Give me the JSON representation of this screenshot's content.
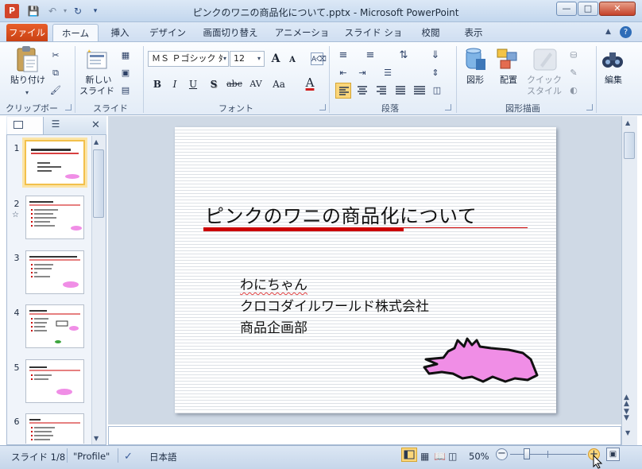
{
  "window": {
    "title": "ピンクのワニの商品化について.pptx - Microsoft PowerPoint",
    "app_icon_letter": "P"
  },
  "tabs": [
    "ファイル",
    "ホーム",
    "挿入",
    "デザイン",
    "画面切り替え",
    "アニメーション",
    "スライド ショー",
    "校閲",
    "表示"
  ],
  "ribbon": {
    "clipboard": {
      "paste_label": "貼り付け",
      "group_label": "クリップボード"
    },
    "slides": {
      "new_slide_label_1": "新しい",
      "new_slide_label_2": "スライド",
      "group_label": "スライド"
    },
    "font": {
      "font_name": "ＭＳ Ｐゴシック ﾀ",
      "font_size": "12",
      "group_label": "フォント",
      "bold": "B",
      "italic": "I",
      "underline": "U",
      "shadow": "S",
      "strike": "abc",
      "spacing": "AV",
      "case": "Aa",
      "color": "A",
      "grow": "A",
      "shrink": "A"
    },
    "paragraph": {
      "group_label": "段落"
    },
    "drawing": {
      "shapes_label": "図形",
      "arrange_label": "配置",
      "quick_label_1": "クイック",
      "quick_label_2": "スタイル",
      "group_label": "図形描画"
    },
    "editing": {
      "label": "編集"
    }
  },
  "left_pane": {
    "slide_numbers": [
      "1",
      "2",
      "3",
      "4",
      "5",
      "6"
    ]
  },
  "slide": {
    "title": "ピンクのワニの商品化について",
    "subtitle_lines": [
      "わにちゃん",
      "クロコダイルワールド株式会社",
      "商品企画部"
    ],
    "accent_color": "#cc0000",
    "croc_color": "#f08ee6"
  },
  "status": {
    "slide_position": "スライド 1/8",
    "theme": "\"Profile\"",
    "language": "日本語",
    "zoom": "50%",
    "zoom_level": 0.5
  },
  "colors": {
    "file_tab": "#d44a18",
    "ribbon_bg": "#e3ecf7",
    "canvas_bg": "#cfd9e5"
  }
}
